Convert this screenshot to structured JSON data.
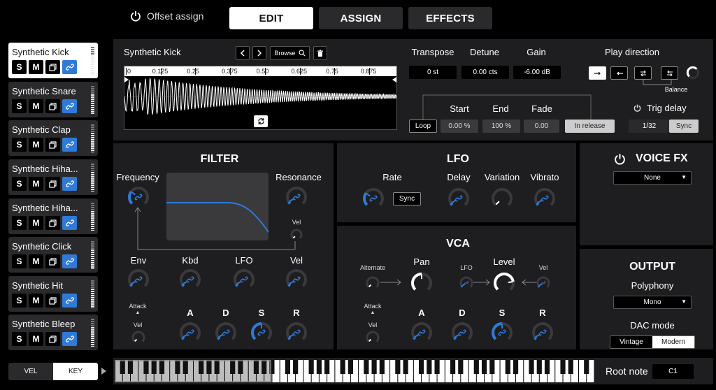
{
  "topbar": {
    "offset_assign": "Offset assign",
    "tabs": [
      {
        "label": "EDIT",
        "active": true
      },
      {
        "label": "ASSIGN",
        "active": false
      },
      {
        "label": "EFFECTS",
        "active": false
      }
    ]
  },
  "colors": {
    "accent": "#2f7ad6",
    "panel": "#1e1e20",
    "button": "#2a2a2c"
  },
  "sidebar": {
    "slots": [
      {
        "name": "Synthetic Kick",
        "selected": true,
        "level": 0.7
      },
      {
        "name": "Synthetic Snare",
        "selected": false,
        "level": 0.7
      },
      {
        "name": "Synthetic Clap",
        "selected": false,
        "level": 0.7
      },
      {
        "name": "Synthetic Hiha...",
        "selected": false,
        "level": 0.7
      },
      {
        "name": "Synthetic Hiha...",
        "selected": false,
        "level": 0.7
      },
      {
        "name": "Synthetic Click",
        "selected": false,
        "level": 0.7
      },
      {
        "name": "Synthetic Hit",
        "selected": false,
        "level": 0.7
      },
      {
        "name": "Synthetic Bleep",
        "selected": false,
        "level": 0.7
      }
    ],
    "solo": "S",
    "mute": "M",
    "vel": "VEL",
    "key": "KEY"
  },
  "sample": {
    "name": "Synthetic Kick",
    "browse": "Browse",
    "ruler": [
      "0",
      "0.125",
      "0.25",
      "0.375",
      "0.50",
      "0.625",
      "0.75",
      "0.875"
    ]
  },
  "params": {
    "transpose_label": "Transpose",
    "transpose": "0 st",
    "detune_label": "Detune",
    "detune": "0.00 cts",
    "gain_label": "Gain",
    "gain": "-6.00 dB",
    "play_direction": "Play direction",
    "balance": "Balance",
    "start_label": "Start",
    "start": "0.00 %",
    "end_label": "End",
    "end": "100 %",
    "fade_label": "Fade",
    "fade": "0.00",
    "loop": "Loop",
    "in_release": "In release",
    "trig_delay": "Trig delay",
    "trig_value": "1/32",
    "trig_sync": "Sync"
  },
  "filter": {
    "title": "FILTER",
    "frequency": "Frequency",
    "resonance": "Resonance",
    "vel_small": "Vel",
    "env": "Env",
    "kbd": "Kbd",
    "lfo": "LFO",
    "vel": "Vel",
    "attack": "Attack",
    "attack_vel": "Vel",
    "a": "A",
    "d": "D",
    "s": "S",
    "r": "R"
  },
  "lfo": {
    "title": "LFO",
    "rate": "Rate",
    "sync": "Sync",
    "delay": "Delay",
    "variation": "Variation",
    "vibrato": "Vibrato"
  },
  "vca": {
    "title": "VCA",
    "alternate": "Alternate",
    "pan": "Pan",
    "lfo": "LFO",
    "level": "Level",
    "vel": "Vel",
    "attack": "Attack",
    "attack_vel": "Vel",
    "a": "A",
    "d": "D",
    "s": "S",
    "r": "R"
  },
  "voicefx": {
    "title": "VOICE FX",
    "value": "None"
  },
  "output": {
    "title": "OUTPUT",
    "polyphony_label": "Polyphony",
    "polyphony": "Mono",
    "dac_label": "DAC mode",
    "dac_options": [
      "Vintage",
      "Modern"
    ],
    "dac_selected": "Modern"
  },
  "keyboard": {
    "root_label": "Root note",
    "root": "C1"
  }
}
